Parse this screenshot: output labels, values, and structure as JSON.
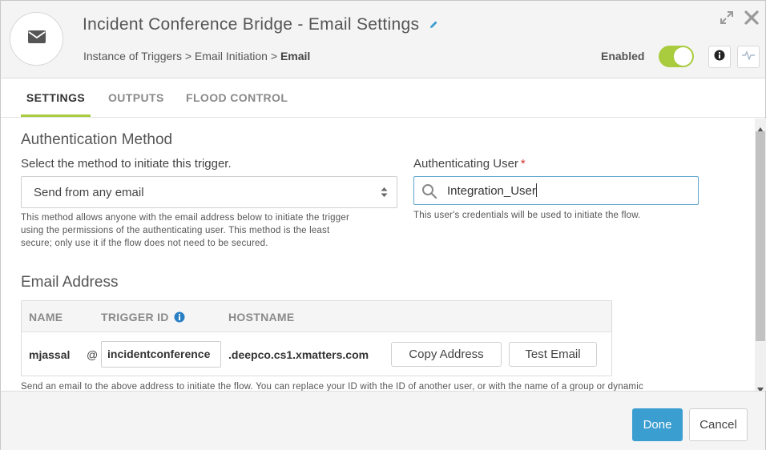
{
  "header": {
    "title": "Incident Conference Bridge - Email Settings",
    "breadcrumb": {
      "part1": "Instance of Triggers",
      "sep1": " > ",
      "part2": "Email Initiation",
      "sep2": " > ",
      "current": "Email"
    },
    "enabled_label": "Enabled",
    "enabled": true
  },
  "tabs": [
    {
      "label": "SETTINGS",
      "active": true
    },
    {
      "label": "OUTPUTS",
      "active": false
    },
    {
      "label": "FLOOD CONTROL",
      "active": false
    }
  ],
  "auth": {
    "section_title": "Authentication Method",
    "method_label": "Select the method to initiate this trigger.",
    "method_value": "Send from any email",
    "method_help_line1": "This method allows anyone with the email address below to initiate the trigger",
    "method_help_line2": "using the permissions of the authenticating user. This method is the least",
    "method_help_line3": "secure; only use it if the flow does not need to be secured.",
    "user_label": "Authenticating User",
    "required_mark": "*",
    "user_value": "Integration_User",
    "user_help": "This user's credentials will be used to initiate the flow."
  },
  "email_address": {
    "section_title": "Email Address",
    "columns": [
      "NAME",
      "TRIGGER ID",
      "HOSTNAME"
    ],
    "row": {
      "name": "mjassal",
      "at": "@",
      "trigger_id": "incidentconference",
      "hostname": ".deepco.cs1.xmatters.com"
    },
    "copy_button": "Copy Address",
    "test_button": "Test Email",
    "help": "Send an email to the above address to initiate the flow. You can replace your ID with the ID of another user, or with the name of a group or dynamic"
  },
  "footer": {
    "done_label": "Done",
    "cancel_label": "Cancel"
  },
  "colors": {
    "accent_green": "#a9cb3e",
    "primary_blue": "#3b9ed1",
    "required_red": "#d0312d",
    "info_blue": "#2a7fc4"
  }
}
